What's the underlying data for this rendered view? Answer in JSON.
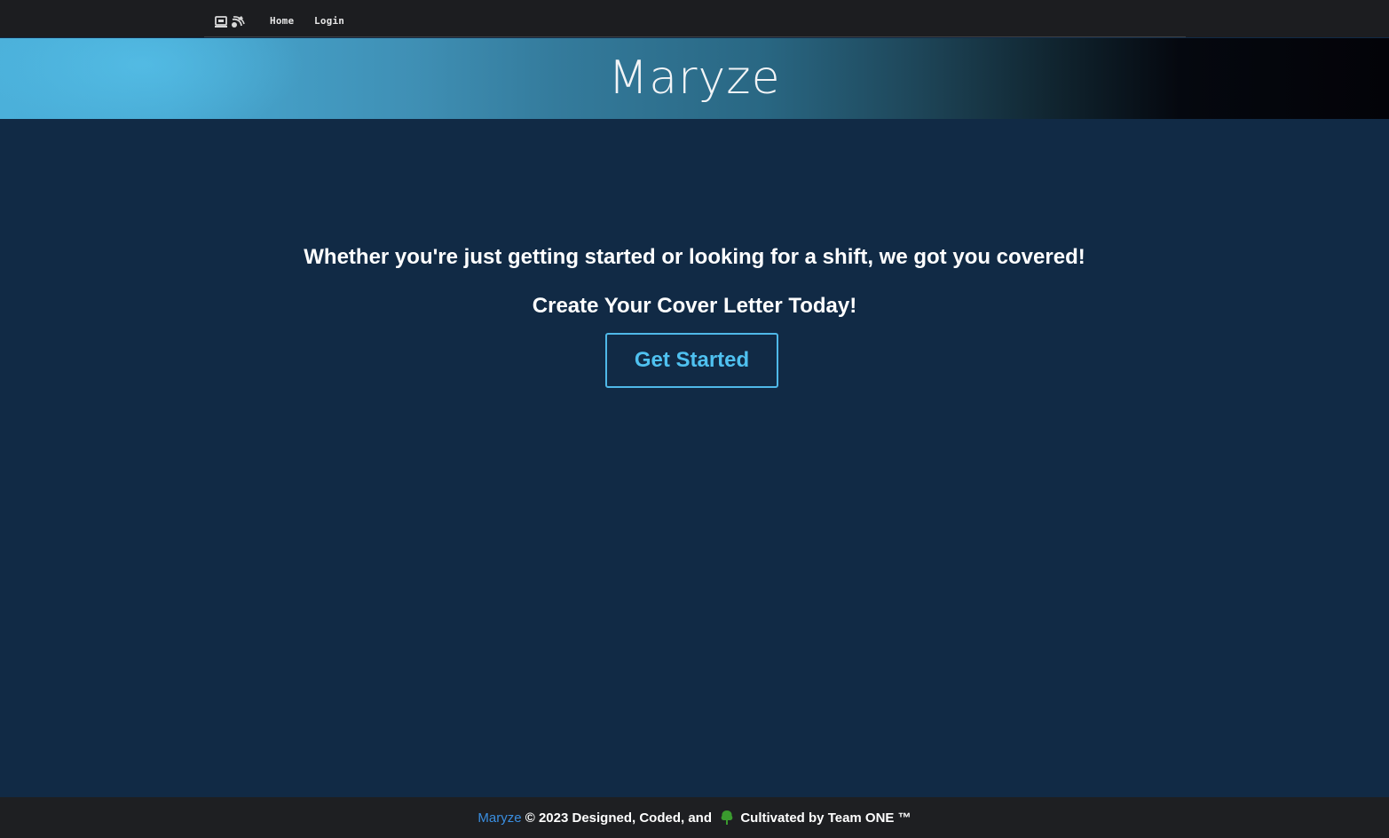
{
  "nav": {
    "logo_icon": "laptop-satellite-icon",
    "links": [
      {
        "label": "Home"
      },
      {
        "label": "Login"
      }
    ]
  },
  "banner": {
    "title": "Maryze"
  },
  "main": {
    "tagline": "Whether you're just getting started or looking for a shift, we got you covered!",
    "cta_text": "Create Your Cover Letter Today!",
    "button_label": "Get Started"
  },
  "footer": {
    "brand": "Maryze",
    "text_before_icon": " © 2023 Designed, Coded, and ",
    "icon": "tree-icon",
    "text_after_icon": " Cultivated by Team ONE ™"
  },
  "colors": {
    "page_background": "#112a45",
    "nav_background": "#1c1d20",
    "accent": "#4fc1f0",
    "footer_brand": "#3a8ee0",
    "tree_green": "#3a9a2e"
  }
}
